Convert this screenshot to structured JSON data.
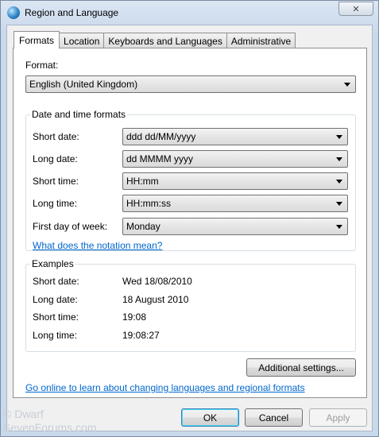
{
  "window": {
    "title": "Region and Language",
    "close_glyph": "✕"
  },
  "tabs": [
    {
      "label": "Formats"
    },
    {
      "label": "Location"
    },
    {
      "label": "Keyboards and Languages"
    },
    {
      "label": "Administrative"
    }
  ],
  "format": {
    "label": "Format:",
    "value": "English (United Kingdom)"
  },
  "date_time_formats": {
    "title": "Date and time formats",
    "short_date": {
      "label": "Short date:",
      "value": "ddd dd/MM/yyyy"
    },
    "long_date": {
      "label": "Long date:",
      "value": "dd MMMM yyyy"
    },
    "short_time": {
      "label": "Short time:",
      "value": "HH:mm"
    },
    "long_time": {
      "label": "Long time:",
      "value": "HH:mm:ss"
    },
    "first_day": {
      "label": "First day of week:",
      "value": "Monday"
    },
    "notation_link": "What does the notation mean?"
  },
  "examples": {
    "title": "Examples",
    "short_date": {
      "label": "Short date:",
      "value": "Wed 18/08/2010"
    },
    "long_date": {
      "label": "Long date:",
      "value": "18 August 2010"
    },
    "short_time": {
      "label": "Short time:",
      "value": "19:08"
    },
    "long_time": {
      "label": "Long time:",
      "value": "19:08:27"
    }
  },
  "additional_settings": "Additional settings...",
  "online_link": "Go online to learn about changing languages and regional formats",
  "buttons": {
    "ok": "OK",
    "cancel": "Cancel",
    "apply": "Apply"
  },
  "watermark": {
    "line1": "© Dwarf",
    "line2": "SevenForums.com"
  }
}
